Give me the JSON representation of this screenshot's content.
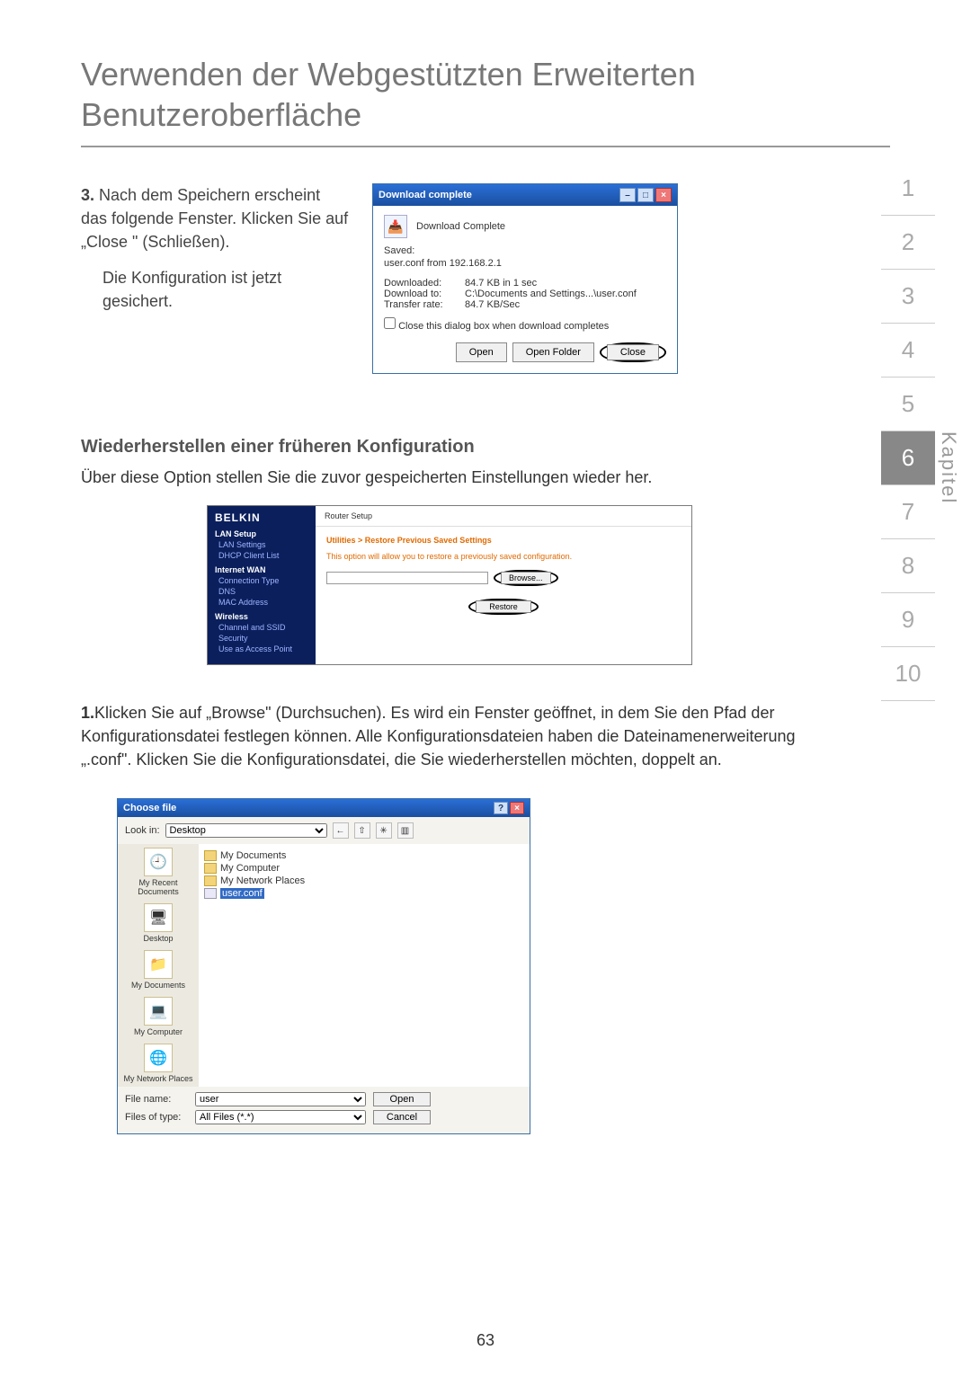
{
  "page": {
    "title": "Verwenden der Webgestützten Erweiterten Benutzeroberfläche",
    "number": "63"
  },
  "chapter_nav": {
    "label": "Kapitel",
    "items": [
      "1",
      "2",
      "3",
      "4",
      "5",
      "6",
      "7",
      "8",
      "9",
      "10"
    ],
    "active_index": 5
  },
  "step3": {
    "num": "3.",
    "p1": "Nach dem Speichern erscheint das folgende Fenster. Klicken Sie auf „Close \" (Schließen).",
    "p2": "Die Konfiguration ist jetzt gesichert."
  },
  "dlg_download": {
    "title": "Download complete",
    "icon": "📥",
    "heading": "Download Complete",
    "saved_label": "Saved:",
    "saved_value": "user.conf from 192.168.2.1",
    "rows": {
      "downloaded_k": "Downloaded:",
      "downloaded_v": "84.7 KB in 1 sec",
      "to_k": "Download to:",
      "to_v": "C:\\Documents and Settings...\\user.conf",
      "rate_k": "Transfer rate:",
      "rate_v": "84.7 KB/Sec"
    },
    "checkbox": "Close this dialog box when download completes",
    "btn_open": "Open",
    "btn_open_folder": "Open Folder",
    "btn_close": "Close"
  },
  "restore": {
    "heading": "Wiederherstellen einer früheren Konfiguration",
    "para": "Über diese Option stellen Sie die zuvor gespeicherten Einstellungen wieder her."
  },
  "belkin": {
    "logo": "BELKIN",
    "topbar": "Router Setup",
    "side": {
      "lan_setup": "LAN Setup",
      "lan_settings": "LAN Settings",
      "dhcp": "DHCP Client List",
      "internet_wan": "Internet WAN",
      "conn_type": "Connection Type",
      "dns": "DNS",
      "mac": "MAC Address",
      "wireless": "Wireless",
      "channel": "Channel and SSID",
      "security": "Security",
      "use_ap": "Use as Access Point"
    },
    "crumb": "Utilities > Restore Previous Saved Settings",
    "desc": "This option will allow you to restore a previously saved configuration.",
    "browse": "Browse...",
    "restore_btn": "Restore"
  },
  "step1": {
    "num": "1.",
    "text": "Klicken Sie auf „Browse\" (Durchsuchen). Es wird ein Fenster geöffnet, in dem Sie den Pfad der Konfigurationsdatei festlegen können. Alle Konfigurationsdateien haben die Dateinamenerweiterung „.conf\". Klicken Sie die Konfigurationsdatei, die Sie wiederherstellen möchten, doppelt an."
  },
  "dlg_choose": {
    "title": "Choose file",
    "lookin_label": "Look in:",
    "lookin_value": "Desktop",
    "places": {
      "recent": "My Recent Documents",
      "desktop": "Desktop",
      "mydocs": "My Documents",
      "mycomp": "My Computer",
      "mynet": "My Network Places"
    },
    "files": {
      "f1": "My Documents",
      "f2": "My Computer",
      "f3": "My Network Places",
      "f4": "user.conf"
    },
    "filename_label": "File name:",
    "filename_value": "user",
    "filetype_label": "Files of type:",
    "filetype_value": "All Files (*.*)",
    "btn_open": "Open",
    "btn_cancel": "Cancel"
  }
}
